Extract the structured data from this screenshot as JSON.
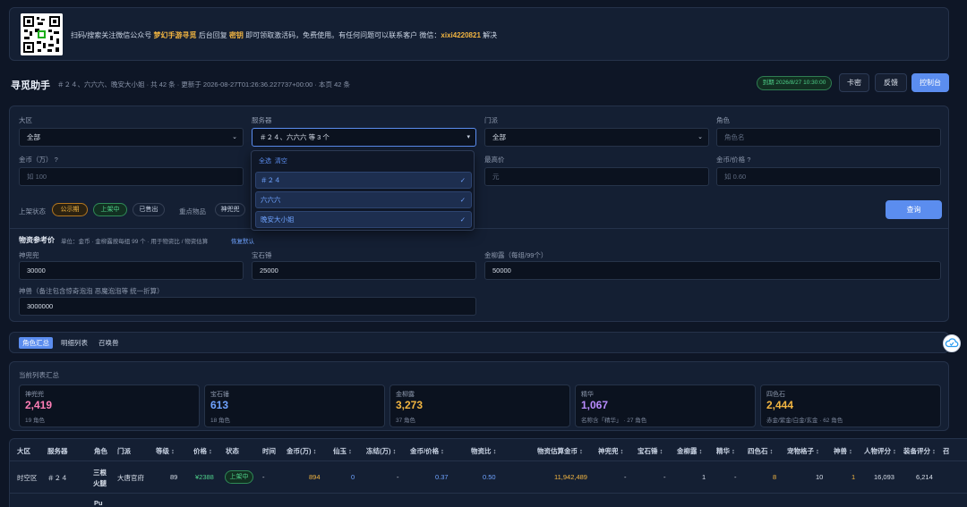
{
  "banner": {
    "prefix": "扫码/搜索关注微信公众号",
    "account": "梦幻手游寻觅",
    "mid": "后台回复",
    "keyword": "密钥",
    "suffix": "即可领取激活码，免费使用。有任何问题可以联系客户 微信：",
    "wechat": "xixi4220821",
    "end": "解决"
  },
  "header": {
    "title": "寻觅助手",
    "meta": "＃２４、六六六、晚安大小姐 · 共 42 条 · 更新于 2026-08-27T01:26:36.227737+00:00 · 本页 42 条",
    "expiry": "到期 2026/8/27 10:30:00",
    "key_label": "卡密",
    "feedback_label": "反馈",
    "console_label": "控制台"
  },
  "filters": {
    "region_label": "大区",
    "region_value": "全部",
    "server_label": "服务器",
    "server_value": "＃２４、六六六 等 3 个",
    "sect_label": "门派",
    "sect_value": "全部",
    "role_label": "角色",
    "role_placeholder": "角色名",
    "gold_label": "金币（万）",
    "gold_placeholder": "如 100",
    "min_price_label": "最高价",
    "min_price_placeholder": "元",
    "ratio_label": "金币/价格",
    "ratio_placeholder": "如 0.60",
    "status_label": "上架状态",
    "status_public": "公示期",
    "status_on": "上架中",
    "status_sold": "已售出",
    "key_items_label": "重点物品",
    "key_items_value": "神兜兜",
    "query_label": "查询",
    "help": "?"
  },
  "dropdown": {
    "select_all": "全选",
    "clear": "清空",
    "options": [
      "＃２４",
      "六六六",
      "晚安大小姐"
    ],
    "check": "✓"
  },
  "ref_price": {
    "title": "物资参考价",
    "desc": "单位：金币 · 金柳露按每组 99 个 · 用于物资比 / 物资估算",
    "restore": "恢复默认",
    "shen_label": "神兜兜",
    "shen_value": "30000",
    "gem_label": "宝石锤",
    "gem_value": "25000",
    "liulu_label": "金柳露（每组/99个）",
    "liulu_value": "50000",
    "beast_label": "神兽（备注包含惊奇泡泡 恶魔泡泡等 统一折算）",
    "beast_value": "3000000"
  },
  "tabs": [
    "角色汇总",
    "明细列表",
    "召唤兽"
  ],
  "summary": {
    "title": "当前列表汇总",
    "stats": [
      {
        "label": "神兜兜",
        "value": "2,419",
        "sub": "19 角色",
        "color": "#ff7eb6"
      },
      {
        "label": "宝石锤",
        "value": "613",
        "sub": "18 角色",
        "color": "#6fa3ff"
      },
      {
        "label": "金柳露",
        "value": "3,273",
        "sub": "37 角色",
        "color": "#f2b541"
      },
      {
        "label": "精华",
        "value": "1,067",
        "sub": "名称含「精华」 · 27 角色",
        "color": "#b98cff"
      },
      {
        "label": "四色石",
        "value": "2,444",
        "sub": "赤金/紫金/白金/玄金 · 62 角色",
        "color": "#f2b541"
      }
    ]
  },
  "table": {
    "headers": [
      "大区",
      "服务器",
      "角色",
      "门派",
      "等级 ↕",
      "价格 ↕",
      "状态",
      "时间",
      "金币(万) ↕",
      "仙玉 ↕",
      "冻结(万) ↕",
      "金币/价格 ↕",
      "物资比 ↕",
      "物资估算金币 ↕",
      "神兜兜 ↕",
      "宝石锤 ↕",
      "金柳露 ↕",
      "精华 ↕",
      "四色石 ↕",
      "宠物格子 ↕",
      "神兽 ↕",
      "人物评分 ↕",
      "装备评分 ↕",
      "召"
    ],
    "row": {
      "region": "时空区",
      "server": "＃２４",
      "role_line1": "三根",
      "role_line2": "火腿",
      "sect": "大唐官府",
      "level": "89",
      "price": "¥2388",
      "status": "上架中",
      "time": "-",
      "gold": "894",
      "xianyu": "0",
      "frozen": "-",
      "ratio": "0.37",
      "supply_ratio": "0.50",
      "estimate": "11,942,489",
      "shen": "-",
      "gem": "-",
      "liulu": "1",
      "jinghua": "-",
      "stone": "8",
      "pet": "10",
      "beast": "1",
      "role_score": "16,093",
      "equip_score": "6,214"
    },
    "next_row_role": "Pu"
  },
  "colors": {
    "accent": "#5b8def",
    "gold": "#f2b541",
    "green": "#4fd18b",
    "blue": "#6fa3ff"
  }
}
